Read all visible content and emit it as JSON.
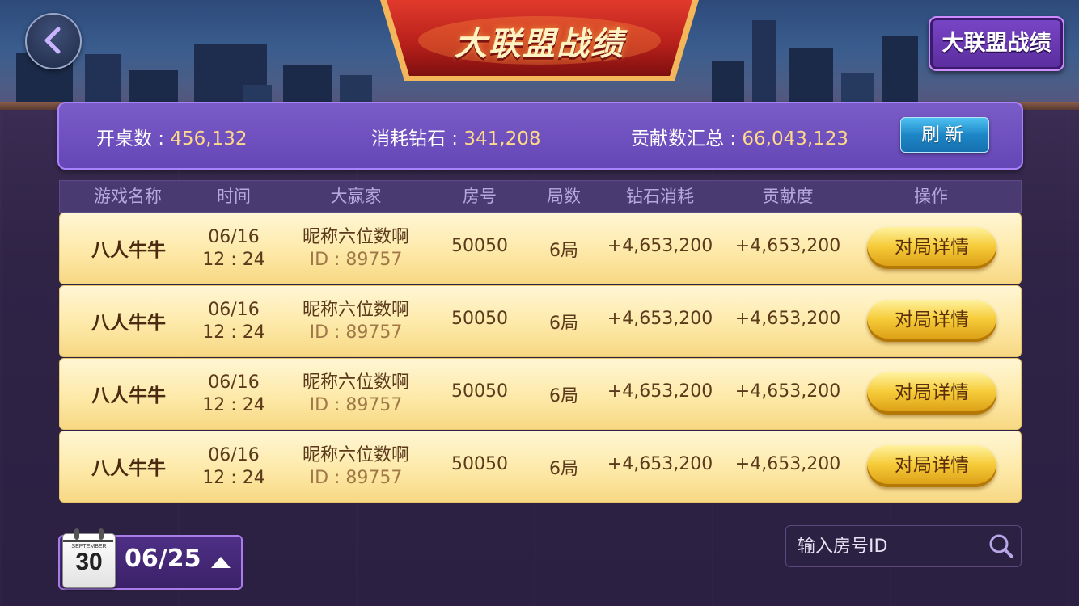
{
  "header": {
    "title": "大联盟战绩",
    "right_button_label": "大联盟战绩"
  },
  "summary": {
    "tables_label": "开桌数 : ",
    "tables_value": "456,132",
    "diamonds_label": "消耗钻石 : ",
    "diamonds_value": "341,208",
    "contrib_label": "贡献数汇总 : ",
    "contrib_value": "66,043,123",
    "refresh_label": "刷新"
  },
  "table": {
    "columns": [
      "游戏名称",
      "时间",
      "大赢家",
      "房号",
      "局数",
      "钻石消耗",
      "贡献度",
      "操作"
    ],
    "rows": [
      {
        "game": "八人牛牛",
        "date": "06/16",
        "time": "12 : 24",
        "winner": "昵称六位数啊",
        "winner_id": "ID : 89757",
        "room": "50050",
        "rounds": "6局",
        "diamonds": "+4,653,200",
        "contribution": "+4,653,200",
        "action": "对局详情"
      },
      {
        "game": "八人牛牛",
        "date": "06/16",
        "time": "12 : 24",
        "winner": "昵称六位数啊",
        "winner_id": "ID : 89757",
        "room": "50050",
        "rounds": "6局",
        "diamonds": "+4,653,200",
        "contribution": "+4,653,200",
        "action": "对局详情"
      },
      {
        "game": "八人牛牛",
        "date": "06/16",
        "time": "12 : 24",
        "winner": "昵称六位数啊",
        "winner_id": "ID : 89757",
        "room": "50050",
        "rounds": "6局",
        "diamonds": "+4,653,200",
        "contribution": "+4,653,200",
        "action": "对局详情"
      },
      {
        "game": "八人牛牛",
        "date": "06/16",
        "time": "12 : 24",
        "winner": "昵称六位数啊",
        "winner_id": "ID : 89757",
        "room": "50050",
        "rounds": "6局",
        "diamonds": "+4,653,200",
        "contribution": "+4,653,200",
        "action": "对局详情"
      }
    ]
  },
  "date_picker": {
    "calendar_month": "SEPTEMBER",
    "calendar_day": "30",
    "selected_date": "06/25"
  },
  "search": {
    "placeholder": "输入房号ID"
  },
  "icons": {
    "back": "back-arrow-icon",
    "calendar": "calendar-icon",
    "dropdown": "triangle-up-icon",
    "search": "magnifier-icon"
  },
  "colors": {
    "summary_value": "#ffd98a",
    "row_bg": "#fde9a8",
    "detail_button": "#f6cc3a",
    "refresh_button": "#1d86c6",
    "header_purple": "#6546b6"
  }
}
